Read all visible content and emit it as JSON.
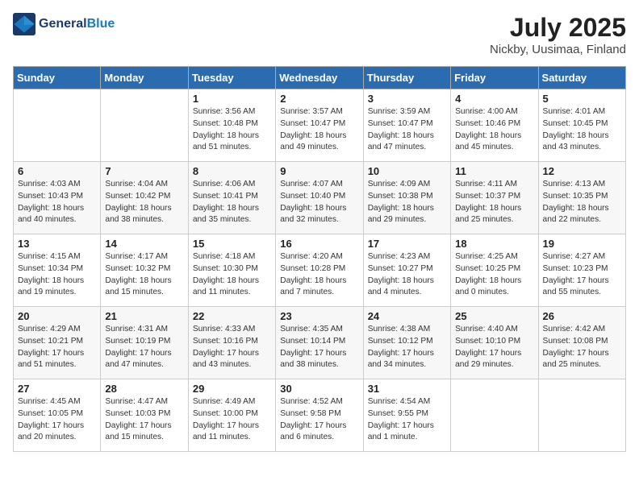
{
  "header": {
    "logo_general": "General",
    "logo_blue": "Blue",
    "month_title": "July 2025",
    "location": "Nickby, Uusimaa, Finland"
  },
  "days_of_week": [
    "Sunday",
    "Monday",
    "Tuesday",
    "Wednesday",
    "Thursday",
    "Friday",
    "Saturday"
  ],
  "weeks": [
    [
      {
        "day": "",
        "sunrise": "",
        "sunset": "",
        "daylight": ""
      },
      {
        "day": "",
        "sunrise": "",
        "sunset": "",
        "daylight": ""
      },
      {
        "day": "1",
        "sunrise": "Sunrise: 3:56 AM",
        "sunset": "Sunset: 10:48 PM",
        "daylight": "Daylight: 18 hours and 51 minutes."
      },
      {
        "day": "2",
        "sunrise": "Sunrise: 3:57 AM",
        "sunset": "Sunset: 10:47 PM",
        "daylight": "Daylight: 18 hours and 49 minutes."
      },
      {
        "day": "3",
        "sunrise": "Sunrise: 3:59 AM",
        "sunset": "Sunset: 10:47 PM",
        "daylight": "Daylight: 18 hours and 47 minutes."
      },
      {
        "day": "4",
        "sunrise": "Sunrise: 4:00 AM",
        "sunset": "Sunset: 10:46 PM",
        "daylight": "Daylight: 18 hours and 45 minutes."
      },
      {
        "day": "5",
        "sunrise": "Sunrise: 4:01 AM",
        "sunset": "Sunset: 10:45 PM",
        "daylight": "Daylight: 18 hours and 43 minutes."
      }
    ],
    [
      {
        "day": "6",
        "sunrise": "Sunrise: 4:03 AM",
        "sunset": "Sunset: 10:43 PM",
        "daylight": "Daylight: 18 hours and 40 minutes."
      },
      {
        "day": "7",
        "sunrise": "Sunrise: 4:04 AM",
        "sunset": "Sunset: 10:42 PM",
        "daylight": "Daylight: 18 hours and 38 minutes."
      },
      {
        "day": "8",
        "sunrise": "Sunrise: 4:06 AM",
        "sunset": "Sunset: 10:41 PM",
        "daylight": "Daylight: 18 hours and 35 minutes."
      },
      {
        "day": "9",
        "sunrise": "Sunrise: 4:07 AM",
        "sunset": "Sunset: 10:40 PM",
        "daylight": "Daylight: 18 hours and 32 minutes."
      },
      {
        "day": "10",
        "sunrise": "Sunrise: 4:09 AM",
        "sunset": "Sunset: 10:38 PM",
        "daylight": "Daylight: 18 hours and 29 minutes."
      },
      {
        "day": "11",
        "sunrise": "Sunrise: 4:11 AM",
        "sunset": "Sunset: 10:37 PM",
        "daylight": "Daylight: 18 hours and 25 minutes."
      },
      {
        "day": "12",
        "sunrise": "Sunrise: 4:13 AM",
        "sunset": "Sunset: 10:35 PM",
        "daylight": "Daylight: 18 hours and 22 minutes."
      }
    ],
    [
      {
        "day": "13",
        "sunrise": "Sunrise: 4:15 AM",
        "sunset": "Sunset: 10:34 PM",
        "daylight": "Daylight: 18 hours and 19 minutes."
      },
      {
        "day": "14",
        "sunrise": "Sunrise: 4:17 AM",
        "sunset": "Sunset: 10:32 PM",
        "daylight": "Daylight: 18 hours and 15 minutes."
      },
      {
        "day": "15",
        "sunrise": "Sunrise: 4:18 AM",
        "sunset": "Sunset: 10:30 PM",
        "daylight": "Daylight: 18 hours and 11 minutes."
      },
      {
        "day": "16",
        "sunrise": "Sunrise: 4:20 AM",
        "sunset": "Sunset: 10:28 PM",
        "daylight": "Daylight: 18 hours and 7 minutes."
      },
      {
        "day": "17",
        "sunrise": "Sunrise: 4:23 AM",
        "sunset": "Sunset: 10:27 PM",
        "daylight": "Daylight: 18 hours and 4 minutes."
      },
      {
        "day": "18",
        "sunrise": "Sunrise: 4:25 AM",
        "sunset": "Sunset: 10:25 PM",
        "daylight": "Daylight: 18 hours and 0 minutes."
      },
      {
        "day": "19",
        "sunrise": "Sunrise: 4:27 AM",
        "sunset": "Sunset: 10:23 PM",
        "daylight": "Daylight: 17 hours and 55 minutes."
      }
    ],
    [
      {
        "day": "20",
        "sunrise": "Sunrise: 4:29 AM",
        "sunset": "Sunset: 10:21 PM",
        "daylight": "Daylight: 17 hours and 51 minutes."
      },
      {
        "day": "21",
        "sunrise": "Sunrise: 4:31 AM",
        "sunset": "Sunset: 10:19 PM",
        "daylight": "Daylight: 17 hours and 47 minutes."
      },
      {
        "day": "22",
        "sunrise": "Sunrise: 4:33 AM",
        "sunset": "Sunset: 10:16 PM",
        "daylight": "Daylight: 17 hours and 43 minutes."
      },
      {
        "day": "23",
        "sunrise": "Sunrise: 4:35 AM",
        "sunset": "Sunset: 10:14 PM",
        "daylight": "Daylight: 17 hours and 38 minutes."
      },
      {
        "day": "24",
        "sunrise": "Sunrise: 4:38 AM",
        "sunset": "Sunset: 10:12 PM",
        "daylight": "Daylight: 17 hours and 34 minutes."
      },
      {
        "day": "25",
        "sunrise": "Sunrise: 4:40 AM",
        "sunset": "Sunset: 10:10 PM",
        "daylight": "Daylight: 17 hours and 29 minutes."
      },
      {
        "day": "26",
        "sunrise": "Sunrise: 4:42 AM",
        "sunset": "Sunset: 10:08 PM",
        "daylight": "Daylight: 17 hours and 25 minutes."
      }
    ],
    [
      {
        "day": "27",
        "sunrise": "Sunrise: 4:45 AM",
        "sunset": "Sunset: 10:05 PM",
        "daylight": "Daylight: 17 hours and 20 minutes."
      },
      {
        "day": "28",
        "sunrise": "Sunrise: 4:47 AM",
        "sunset": "Sunset: 10:03 PM",
        "daylight": "Daylight: 17 hours and 15 minutes."
      },
      {
        "day": "29",
        "sunrise": "Sunrise: 4:49 AM",
        "sunset": "Sunset: 10:00 PM",
        "daylight": "Daylight: 17 hours and 11 minutes."
      },
      {
        "day": "30",
        "sunrise": "Sunrise: 4:52 AM",
        "sunset": "Sunset: 9:58 PM",
        "daylight": "Daylight: 17 hours and 6 minutes."
      },
      {
        "day": "31",
        "sunrise": "Sunrise: 4:54 AM",
        "sunset": "Sunset: 9:55 PM",
        "daylight": "Daylight: 17 hours and 1 minute."
      },
      {
        "day": "",
        "sunrise": "",
        "sunset": "",
        "daylight": ""
      },
      {
        "day": "",
        "sunrise": "",
        "sunset": "",
        "daylight": ""
      }
    ]
  ]
}
